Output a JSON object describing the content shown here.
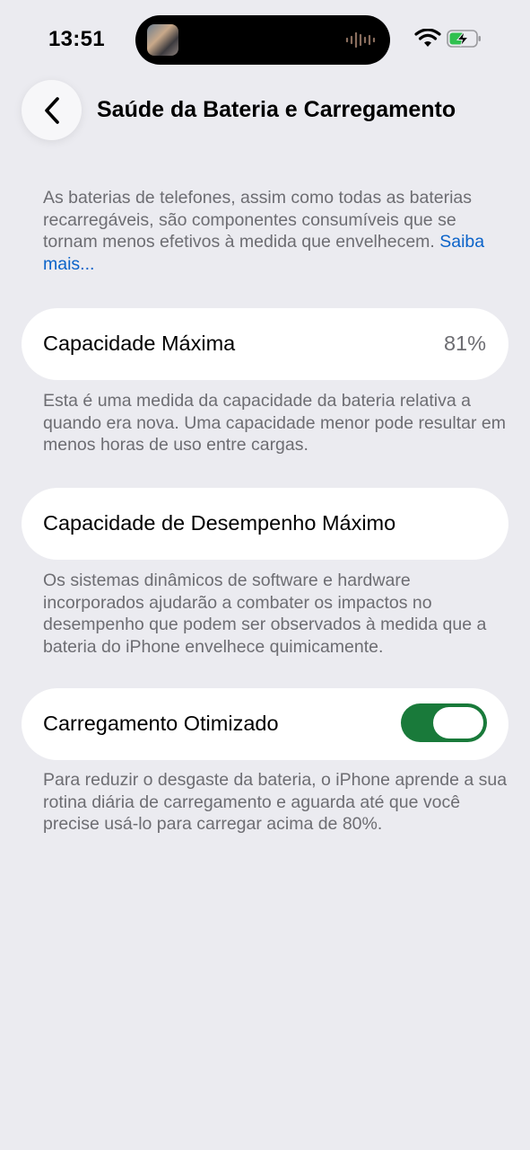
{
  "status_bar": {
    "time": "13:51",
    "island_icons": [
      "contact-avatar",
      "audio-waveform-icon"
    ],
    "right_icons": [
      "wifi-icon",
      "battery-charging-icon"
    ]
  },
  "nav": {
    "back_icon": "chevron-left-icon",
    "title": "Saúde da Bateria e Carregamento"
  },
  "intro": {
    "text": "As baterias de telefones, assim como todas as baterias recarregáveis, são componentes consumíveis que se tornam menos efetivos à medida que envelhecem.",
    "link": "Saiba mais..."
  },
  "max_capacity": {
    "label": "Capacidade Máxima",
    "value": "81%",
    "footnote": "Esta é uma medida da capacidade da bateria relativa a quando era nova. Uma capacidade menor pode resultar em menos horas de uso entre cargas."
  },
  "peak_performance": {
    "label": "Capacidade de Desempenho Máximo",
    "footnote": "Os sistemas dinâmicos de software e hardware incorporados ajudarão a combater os impactos no desempenho que podem ser observados à medida que a bateria do iPhone envelhece quimicamente."
  },
  "optimized_charging": {
    "label": "Carregamento Otimizado",
    "enabled": true,
    "footnote": "Para reduzir o desgaste da bateria, o iPhone aprende a sua rotina diária de carregamento e aguarda até que você precise usá-lo para carregar acima de 80%."
  },
  "colors": {
    "background": "#ebebf0",
    "card": "#ffffff",
    "secondary_text": "#6d6d72",
    "link": "#0b63c9",
    "toggle_on": "#197a3a"
  }
}
